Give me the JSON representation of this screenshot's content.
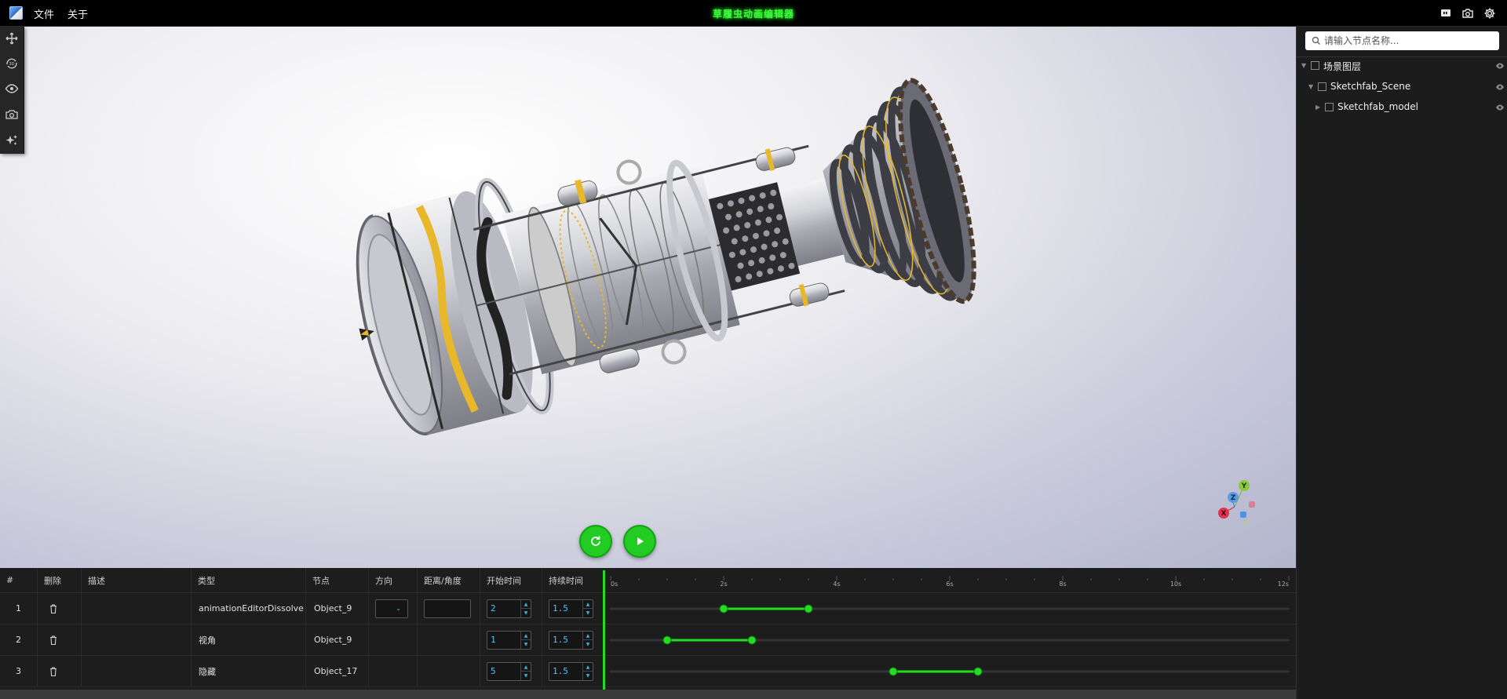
{
  "menu": {
    "file": "文件",
    "about": "关于"
  },
  "app_title": "草履虫动画编辑器",
  "top_icons": [
    "presentation-icon",
    "camera-icon",
    "gear-icon"
  ],
  "left_tools": [
    "move-icon",
    "rotate-3d-icon",
    "eye-icon",
    "camera-icon",
    "sparkle-icon"
  ],
  "gizmo": {
    "y": "Y",
    "z": "Z",
    "x": "X"
  },
  "controls": {
    "replay": "replay-icon",
    "play": "play-icon"
  },
  "search": {
    "placeholder": "请输入节点名称..."
  },
  "tree": [
    {
      "label": "场景图层",
      "expanded": true,
      "level": 0
    },
    {
      "label": "Sketchfab_Scene",
      "expanded": true,
      "level": 1
    },
    {
      "label": "Sketchfab_model",
      "expanded": false,
      "level": 2
    }
  ],
  "table": {
    "headers": [
      "#",
      "删除",
      "描述",
      "类型",
      "节点",
      "方向",
      "距离/角度",
      "开始时间",
      "持续时间"
    ],
    "rows": [
      {
        "index": "1",
        "description": "",
        "type": "animationEditorDissolve",
        "node": "Object_9",
        "direction": "",
        "distance": "",
        "start": "2",
        "duration": "1.5"
      },
      {
        "index": "2",
        "description": "",
        "type": "视角",
        "node": "Object_9",
        "direction": "",
        "distance": "",
        "start": "1",
        "duration": "1.5"
      },
      {
        "index": "3",
        "description": "",
        "type": "隐藏",
        "node": "Object_17",
        "direction": "",
        "distance": "",
        "start": "5",
        "duration": "1.5"
      }
    ]
  },
  "timeline": {
    "ticks": [
      "0s",
      "2s",
      "4s",
      "6s",
      "8s",
      "10s",
      "12s"
    ],
    "max_seconds": 12,
    "accent": "#22dd22"
  }
}
